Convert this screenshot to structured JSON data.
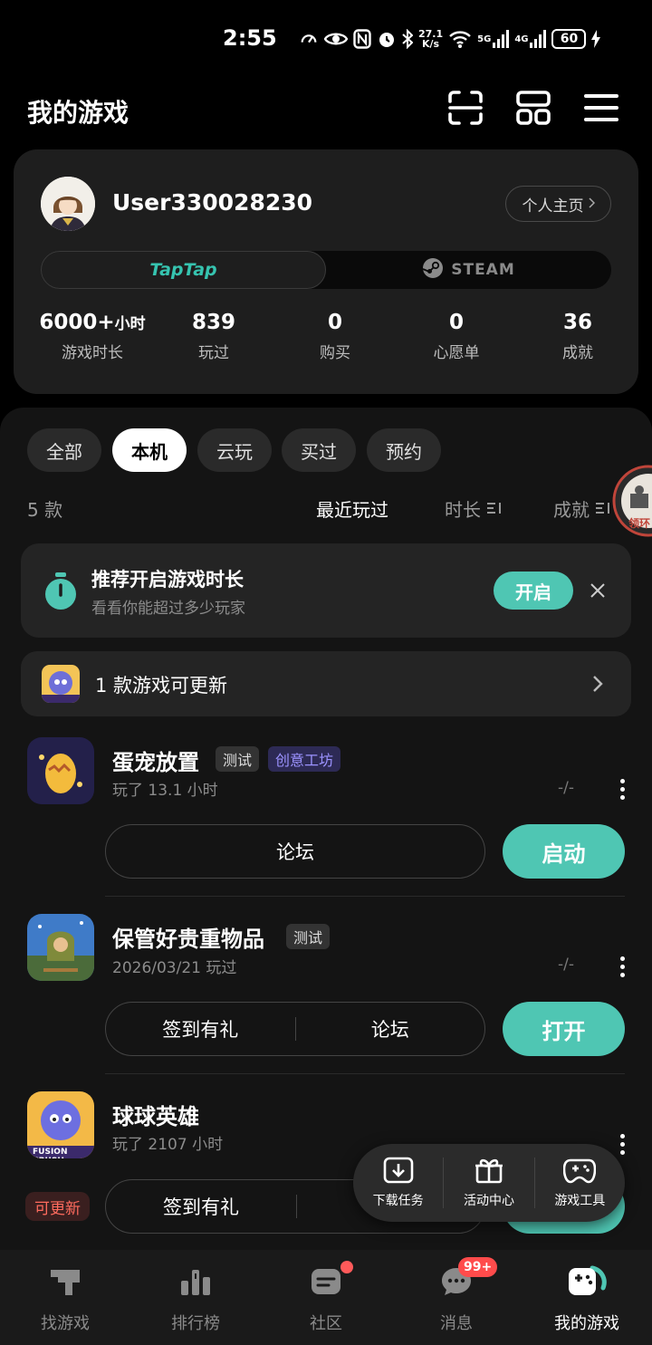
{
  "status_bar": {
    "time": "2:55",
    "net_speed_top": "27.1",
    "net_speed_bottom": "K/s",
    "signal1": "5G",
    "signal2": "4G",
    "battery": "60"
  },
  "header": {
    "title": "我的游戏",
    "icons": [
      "scan-icon",
      "grid-icon",
      "menu-icon"
    ]
  },
  "profile": {
    "username": "User330028230",
    "homepage_label": "个人主页",
    "platforms": {
      "taptap": "TapTap",
      "steam": "STEAM"
    },
    "stats": [
      {
        "value": "6000+",
        "unit": "小时",
        "label": "游戏时长"
      },
      {
        "value": "839",
        "unit": "",
        "label": "玩过"
      },
      {
        "value": "0",
        "unit": "",
        "label": "购买"
      },
      {
        "value": "0",
        "unit": "",
        "label": "心愿单"
      },
      {
        "value": "36",
        "unit": "",
        "label": "成就"
      }
    ]
  },
  "filters": {
    "chips": [
      "全部",
      "本机",
      "云玩",
      "买过",
      "预约"
    ],
    "active": "本机"
  },
  "list_header": {
    "count": "5 款",
    "sort_recent": "最近玩过",
    "sort_duration": "时长",
    "sort_achievement": "成就"
  },
  "float_widget": {
    "label": "领环"
  },
  "banner": {
    "title": "推荐开启游戏时长",
    "subtitle": "看看你能超过多少玩家",
    "button": "开启"
  },
  "update_row": {
    "text": "1 款游戏可更新",
    "icon_text": "FUSION CRUSH"
  },
  "games": [
    {
      "title": "蛋宠放置",
      "tags": [
        "测试",
        "创意工坊"
      ],
      "sub": "玩了 13.1 小时",
      "dash": "-/-",
      "buttons": [
        "论坛"
      ],
      "primary": "启动"
    },
    {
      "title": "保管好贵重物品",
      "tags": [
        "测试"
      ],
      "sub": "2026/03/21 玩过",
      "dash": "-/-",
      "buttons": [
        "签到有礼",
        "论坛"
      ],
      "primary": "打开"
    },
    {
      "title": "球球英雄",
      "tags": [],
      "sub": "玩了 2107 小时",
      "dash": "-/-",
      "buttons": [
        "签到有礼"
      ],
      "primary": "",
      "badge": "可更新",
      "icon_text": "FUSION CRUSH"
    }
  ],
  "float_menu": [
    {
      "icon": "download-icon",
      "label": "下载任务"
    },
    {
      "icon": "gift-icon",
      "label": "活动中心"
    },
    {
      "icon": "gamepad-icon",
      "label": "游戏工具"
    }
  ],
  "bottom_nav": [
    {
      "icon": "taptap-icon",
      "label": "找游戏"
    },
    {
      "icon": "ranking-icon",
      "label": "排行榜"
    },
    {
      "icon": "community-icon",
      "label": "社区"
    },
    {
      "icon": "message-icon",
      "label": "消息",
      "badge": "99+"
    },
    {
      "icon": "my-games-icon",
      "label": "我的游戏"
    }
  ],
  "colors": {
    "accent": "#4fc6b3",
    "taptap": "#36c4b0",
    "badge": "#ff4b4b",
    "tag_purple": "#9c93ff"
  }
}
